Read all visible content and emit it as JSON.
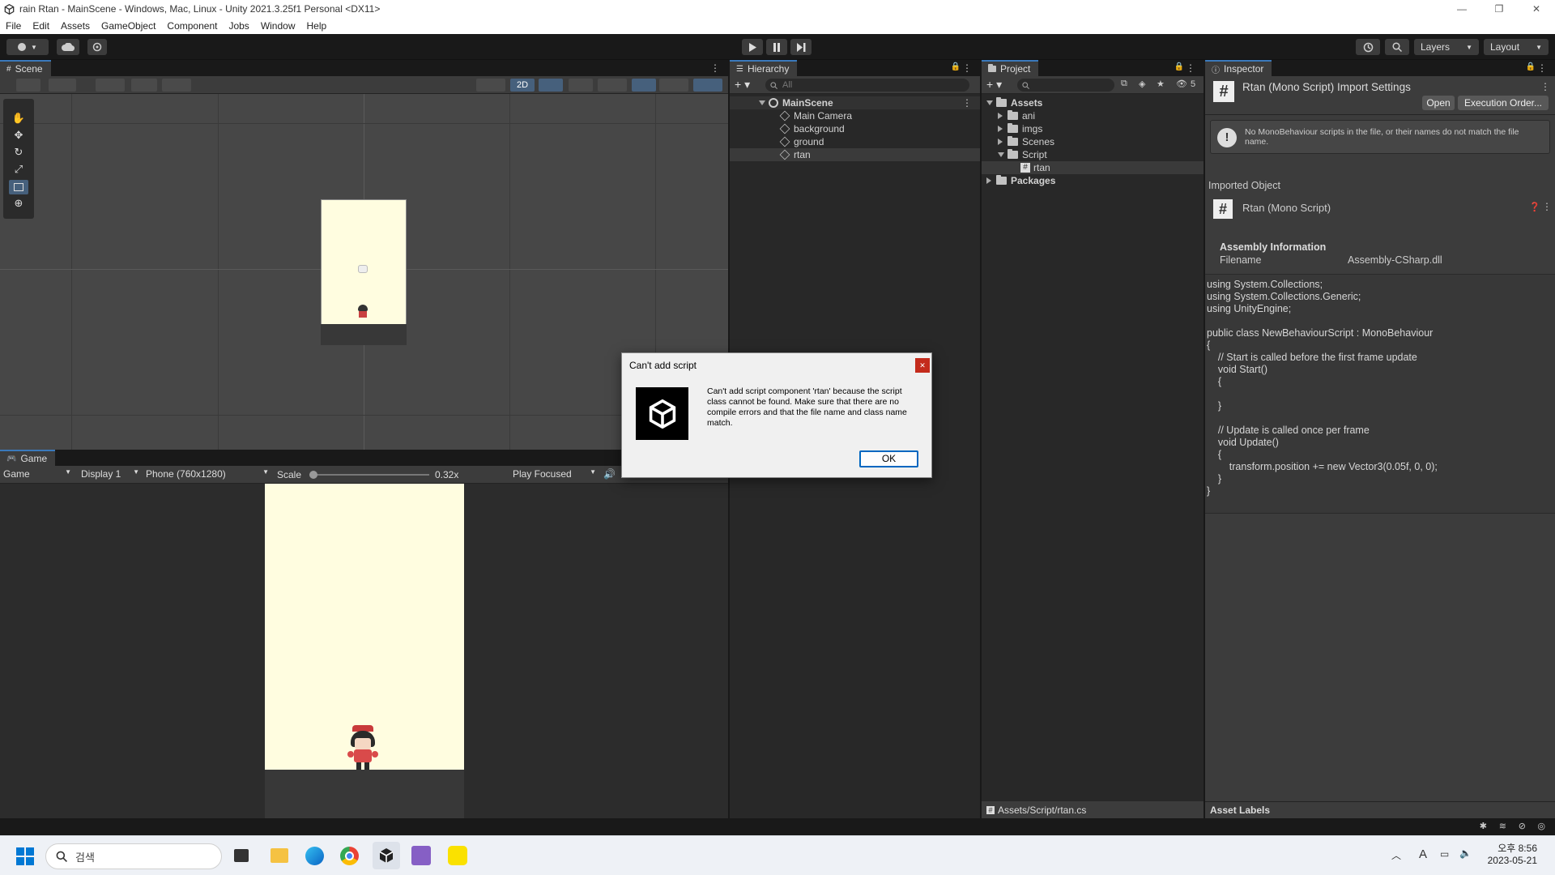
{
  "window": {
    "title": "rain Rtan - MainScene - Windows, Mac, Linux - Unity 2021.3.25f1 Personal <DX11>",
    "controls": [
      "—",
      "❐",
      "✕"
    ]
  },
  "menu": [
    "File",
    "Edit",
    "Assets",
    "GameObject",
    "Component",
    "Jobs",
    "Window",
    "Help"
  ],
  "toolbar": {
    "layers_label": "Layers",
    "layout_label": "Layout"
  },
  "scene": {
    "tab_label": "Scene",
    "mode_2d": "2D"
  },
  "game": {
    "tab_label": "Game",
    "view_select": "Game",
    "display_select": "Display 1",
    "resolution_select": "Phone (760x1280)",
    "scale_label": "Scale",
    "scale_value": "0.32x",
    "play_mode_select": "Play Focused"
  },
  "hierarchy": {
    "tab_label": "Hierarchy",
    "search_placeholder": "All",
    "scene_name": "MainScene",
    "objects": [
      "Main Camera",
      "background",
      "ground",
      "rtan"
    ]
  },
  "project": {
    "tab_label": "Project",
    "root": "Assets",
    "folders": [
      "ani",
      "imgs",
      "Scenes",
      "Script"
    ],
    "script_file": "rtan",
    "packages": "Packages",
    "hidden_count": "5",
    "path": "Assets/Script/rtan.cs"
  },
  "inspector": {
    "tab_label": "Inspector",
    "title": "Rtan (Mono Script) Import Settings",
    "open_button": "Open",
    "execution_order_button": "Execution Order...",
    "warning": "No MonoBehaviour scripts in the file, or their names do not match the file name.",
    "imported_object_label": "Imported Object",
    "imported_object_name": "Rtan (Mono Script)",
    "assembly_info_label": "Assembly Information",
    "filename_label": "Filename",
    "filename_value": "Assembly-CSharp.dll",
    "code": "using System.Collections;\nusing System.Collections.Generic;\nusing UnityEngine;\n\npublic class NewBehaviourScript : MonoBehaviour\n{\n    // Start is called before the first frame update\n    void Start()\n    {\n\n    }\n\n    // Update is called once per frame\n    void Update()\n    {\n        transform.position += new Vector3(0.05f, 0, 0);\n    }\n}",
    "asset_labels": "Asset Labels"
  },
  "dialog": {
    "title": "Can't add script",
    "message": "Can't add script component 'rtan' because the script class cannot be found. Make sure that there are no compile errors and that the file name and class name match.",
    "ok_button": "OK",
    "close_glyph": "✕"
  },
  "taskbar": {
    "search_placeholder": "검색",
    "time": "오후 8:56",
    "date": "2023-05-21",
    "ime": "A"
  },
  "colors": {
    "accent": "#3a79bb",
    "game_bg": "#fffde0",
    "ground": "#383838"
  }
}
